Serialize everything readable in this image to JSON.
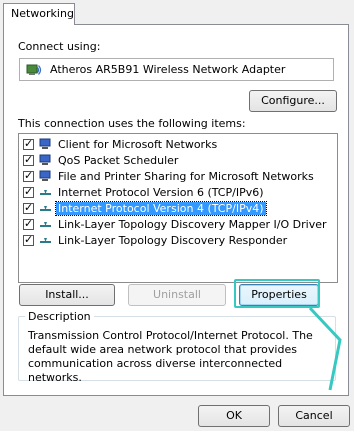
{
  "tab": {
    "label": "Networking"
  },
  "connect_using": {
    "label": "Connect using:",
    "adapter_name": "Atheros AR5B91 Wireless Network Adapter"
  },
  "buttons": {
    "configure": "Configure...",
    "install": "Install...",
    "uninstall": "Uninstall",
    "properties": "Properties",
    "ok": "OK",
    "cancel": "Cancel"
  },
  "items_label": "This connection uses the following items:",
  "items": [
    {
      "label": "Client for Microsoft Networks",
      "checked": true,
      "icon": "network-client-icon",
      "selected": false
    },
    {
      "label": "QoS Packet Scheduler",
      "checked": true,
      "icon": "network-client-icon",
      "selected": false
    },
    {
      "label": "File and Printer Sharing for Microsoft Networks",
      "checked": true,
      "icon": "network-client-icon",
      "selected": false
    },
    {
      "label": "Internet Protocol Version 6 (TCP/IPv6)",
      "checked": true,
      "icon": "protocol-icon",
      "selected": false
    },
    {
      "label": "Internet Protocol Version 4 (TCP/IPv4)",
      "checked": true,
      "icon": "protocol-icon",
      "selected": true
    },
    {
      "label": "Link-Layer Topology Discovery Mapper I/O Driver",
      "checked": true,
      "icon": "protocol-icon",
      "selected": false
    },
    {
      "label": "Link-Layer Topology Discovery Responder",
      "checked": true,
      "icon": "protocol-icon",
      "selected": false
    }
  ],
  "description": {
    "legend": "Description",
    "text": "Transmission Control Protocol/Internet Protocol. The default wide area network protocol that provides communication across diverse interconnected networks."
  },
  "colors": {
    "selection": "#3399ff",
    "highlight_annotation": "#37c8c2"
  }
}
